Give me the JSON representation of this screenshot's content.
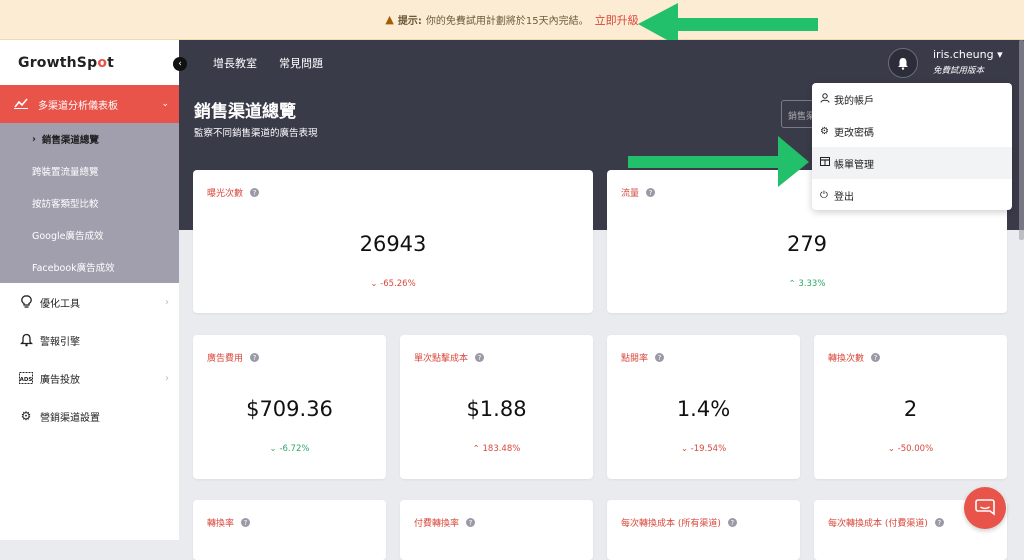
{
  "notice": {
    "label": "提示:",
    "message": "你的免費試用計劃將於15天內完結。",
    "upgrade": "立即升級"
  },
  "sidebar": {
    "brand_prefix": "GrowthSp",
    "brand_dot": "o",
    "brand_suffix": "t",
    "active_item": "多渠道分析儀表板",
    "sub_items": [
      "銷售渠道總覽",
      "跨裝置流量總覽",
      "按訪客類型比較",
      "Google廣告成效",
      "Facebook廣告成效"
    ],
    "menu": [
      {
        "label": "優化工具",
        "icon": "lightbulb-icon"
      },
      {
        "label": "警報引擎",
        "icon": "bell-icon"
      },
      {
        "label": "廣告投放",
        "icon": "ads-icon"
      },
      {
        "label": "營銷渠道設置",
        "icon": "gear-icon"
      }
    ]
  },
  "topbar": {
    "links": [
      "增長教室",
      "常見問題"
    ],
    "username": "iris.cheung",
    "plan": "免費試用版本"
  },
  "hero": {
    "title": "銷售渠道總覽",
    "subtitle": "監察不同銷售渠道的廣告表現",
    "filter_placeholder": "銷售渠"
  },
  "dropdown": {
    "items": [
      "我的帳戶",
      "更改密碼",
      "帳單管理",
      "登出"
    ]
  },
  "metrics": [
    {
      "label": "曝光次數",
      "value": "26943",
      "change": "-65.26%",
      "dir": "down"
    },
    {
      "label": "流量",
      "value": "279",
      "change": "3.33%",
      "dir": "up"
    },
    {
      "label": "廣告費用",
      "value": "$709.36",
      "change": "-6.72%",
      "dir": "up"
    },
    {
      "label": "單次點擊成本",
      "value": "$1.88",
      "change": "183.48%",
      "dir": "down"
    },
    {
      "label": "點閱率",
      "value": "1.4%",
      "change": "-19.54%",
      "dir": "down"
    },
    {
      "label": "轉換次數",
      "value": "2",
      "change": "-50.00%",
      "dir": "down"
    },
    {
      "label": "轉換率"
    },
    {
      "label": "付費轉換率"
    },
    {
      "label": "每次轉換成本 (所有渠道)"
    },
    {
      "label": "每次轉換成本 (付費渠道)"
    }
  ],
  "colors": {
    "accent": "#e8534a",
    "dark": "#3a3b49",
    "up": "#2ca96a",
    "down": "#d9473b",
    "arrow": "#22c06a"
  }
}
